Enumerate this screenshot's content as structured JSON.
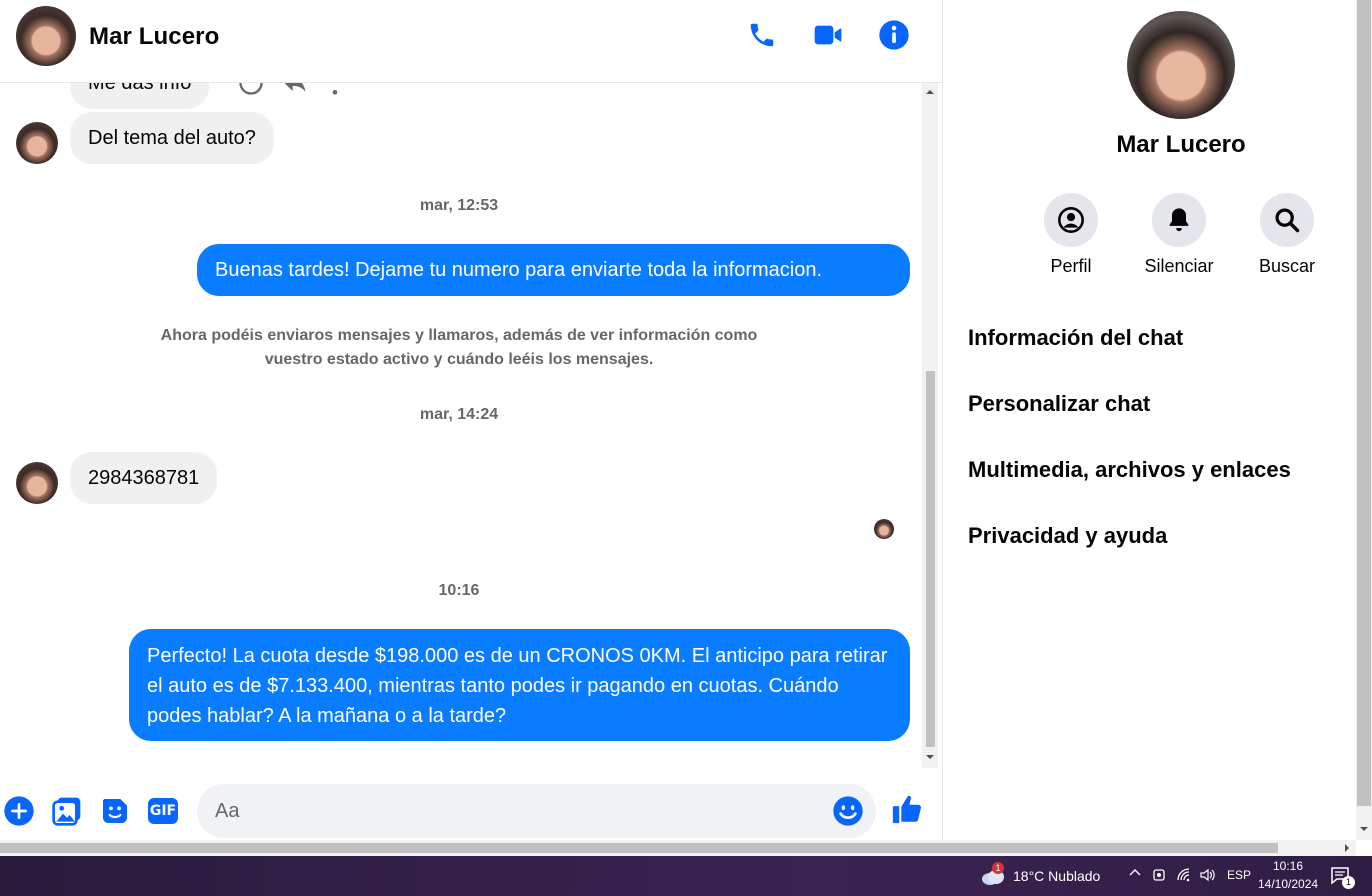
{
  "header": {
    "contact_name": "Mar Lucero"
  },
  "messages": {
    "partial_message": "Me das info",
    "incoming_1": "Del tema del auto?",
    "timestamp_1": "mar, 12:53",
    "outgoing_1": "Buenas tardes! Dejame tu numero para enviarte toda la informacion.",
    "notice": "Ahora podéis enviaros mensajes y llamaros, además de ver información como vuestro estado activo y cuándo leéis los mensajes.",
    "timestamp_2": "mar, 14:24",
    "incoming_2": "2984368781",
    "timestamp_3": "10:16",
    "outgoing_2": "Perfecto! La cuota desde $198.000 es de un CRONOS 0KM. El anticipo para retirar el auto es de $7.133.400, mientras tanto podes ir pagando en cuotas. Cuándo podes hablar? A la mañana o a la tarde?"
  },
  "composer": {
    "placeholder": "Aa",
    "gif_label": "GIF"
  },
  "info_panel": {
    "name": "Mar Lucero",
    "actions": [
      {
        "label": "Perfil",
        "icon": "profile-icon"
      },
      {
        "label": "Silenciar",
        "icon": "bell-icon"
      },
      {
        "label": "Buscar",
        "icon": "search-icon"
      }
    ],
    "sections": [
      "Información del chat",
      "Personalizar chat",
      "Multimedia, archivos y enlaces",
      "Privacidad y ayuda"
    ]
  },
  "taskbar": {
    "weather_badge": "1",
    "weather": "18°C  Nublado",
    "language": "ESP",
    "time": "10:16",
    "date": "14/10/2024",
    "notification_count": "1"
  },
  "colors": {
    "accent": "#0a7cff",
    "icon_blue": "#0866ff",
    "incoming_bubble": "#f0f0f0",
    "muted_text": "#65676b"
  }
}
